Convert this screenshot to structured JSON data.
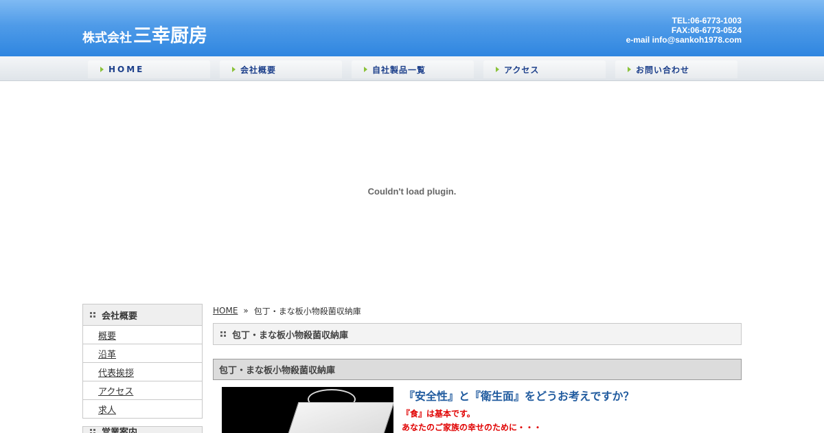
{
  "header": {
    "logo_small": "株式会社",
    "logo_big": "三幸厨房",
    "tel": "TEL:06-6773-1003",
    "fax": "FAX:06-6773-0524",
    "email": "e-mail info@sankoh1978.com"
  },
  "nav": {
    "items": [
      {
        "label": "HOME"
      },
      {
        "label": "会社概要"
      },
      {
        "label": "自社製品一覧"
      },
      {
        "label": "アクセス"
      },
      {
        "label": "お問い合わせ"
      }
    ]
  },
  "plugin": {
    "message": "Couldn't load plugin."
  },
  "sidebar": {
    "heading": "会社概要",
    "items": [
      {
        "label": "概要"
      },
      {
        "label": "沿革"
      },
      {
        "label": "代表挨拶"
      },
      {
        "label": "アクセス"
      },
      {
        "label": "求人"
      }
    ],
    "heading2": "営業案内"
  },
  "breadcrumb": {
    "home": "HOME",
    "separator": "»",
    "current": "包丁・まな板小物殺菌収納庫"
  },
  "main": {
    "page_title": "包丁・まな板小物殺菌収納庫",
    "section_title": "包丁・まな板小物殺菌収納庫",
    "question": "『安全性』と『衛生面』をどうお考えですか？",
    "line1": "『食』は基本です。",
    "line2": "あなたのご家族の幸せのために・・・"
  },
  "colors": {
    "header_blue": "#2f86e0",
    "nav_text": "#1c3f8a",
    "nav_arrow": "#8bc23a",
    "question_blue": "#1f5a9e",
    "accent_red": "#e00000"
  }
}
